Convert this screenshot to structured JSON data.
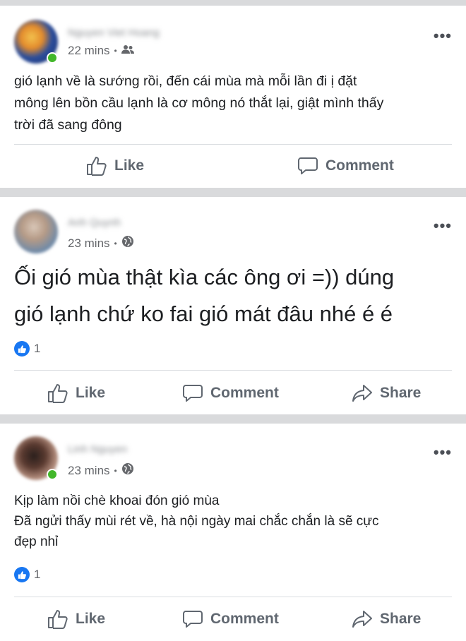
{
  "posts": [
    {
      "author": "Nguyen Viet Hoang",
      "time": "22 mins",
      "audience_icon": "friends-icon",
      "text_lines": [
        "gió lạnh về là sướng rồi, đến cái mùa mà mỗi lần đi ị đặt",
        "mông lên bồn cầu lạnh là cơ mông nó thắt lại, giật mình thấy",
        "trời đã sang đông"
      ],
      "actions": {
        "like": "Like",
        "comment": "Comment"
      }
    },
    {
      "author": "Anh Quynh",
      "time": "23 mins",
      "audience_icon": "globe-icon",
      "text_lines": [
        "Ối gió mùa thật kìa các ông ơi =)) dúng",
        "gió lạnh chứ ko fai gió mát đâu nhé é é"
      ],
      "reaction_count": "1",
      "actions": {
        "like": "Like",
        "comment": "Comment",
        "share": "Share"
      }
    },
    {
      "author": "Linh Nguyen",
      "time": "23 mins",
      "audience_icon": "globe-icon",
      "text_lines": [
        "Kịp làm nồi chè khoai đón gió mùa",
        "Đã ngửi thấy mùi rét về, hà nội ngày mai chắc chắn là sẽ cực",
        "đẹp nhỉ"
      ],
      "reaction_count": "1",
      "actions": {
        "like": "Like",
        "comment": "Comment",
        "share": "Share"
      }
    }
  ],
  "colors": {
    "like_blue": "#1877f2",
    "action_gray": "#606770",
    "feed_bg": "#d9dadc"
  }
}
